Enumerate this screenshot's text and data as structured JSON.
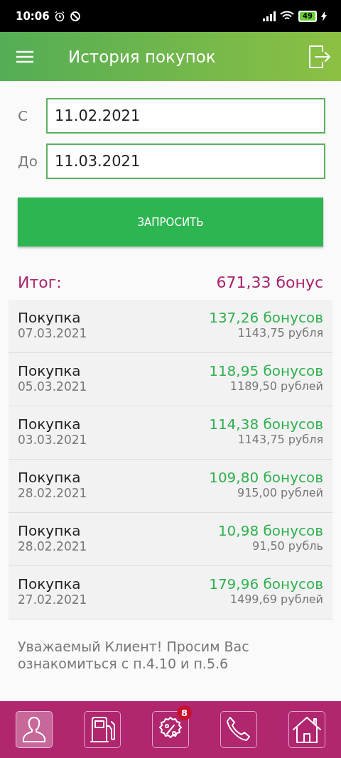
{
  "status_bar": {
    "time": "10:06",
    "battery": "49"
  },
  "header": {
    "title": "История покупок"
  },
  "filters": [
    {
      "label": "С",
      "value": "11.02.2021"
    },
    {
      "label": "До",
      "value": "11.03.2021"
    }
  ],
  "request_button": "ЗАПРОСИТЬ",
  "total": {
    "label": "Итог:",
    "value": "671,33 бонус"
  },
  "purchases": [
    {
      "title": "Покупка",
      "date": "07.03.2021",
      "bonus": "137,26 бонусов",
      "amount": "1143,75 рубля"
    },
    {
      "title": "Покупка",
      "date": "05.03.2021",
      "bonus": "118,95 бонусов",
      "amount": "1189,50 рублей"
    },
    {
      "title": "Покупка",
      "date": "03.03.2021",
      "bonus": "114,38 бонусов",
      "amount": "1143,75 рубля"
    },
    {
      "title": "Покупка",
      "date": "28.02.2021",
      "bonus": "109,80 бонусов",
      "amount": "915,00 рублей"
    },
    {
      "title": "Покупка",
      "date": "28.02.2021",
      "bonus": "10,98 бонусов",
      "amount": "91,50 рубль"
    },
    {
      "title": "Покупка",
      "date": "27.02.2021",
      "bonus": "179,96 бонусов",
      "amount": "1499,69 рублей"
    }
  ],
  "notice": "Уважаемый Клиент! Просим Вас ознакомиться с п.4.10 и п.5.6",
  "bottom_nav": [
    {
      "kind": "profile",
      "selected": true
    },
    {
      "kind": "fuel",
      "selected": false
    },
    {
      "kind": "offers",
      "selected": false,
      "badge": "8"
    },
    {
      "kind": "phone",
      "selected": false
    },
    {
      "kind": "home",
      "selected": false
    }
  ]
}
